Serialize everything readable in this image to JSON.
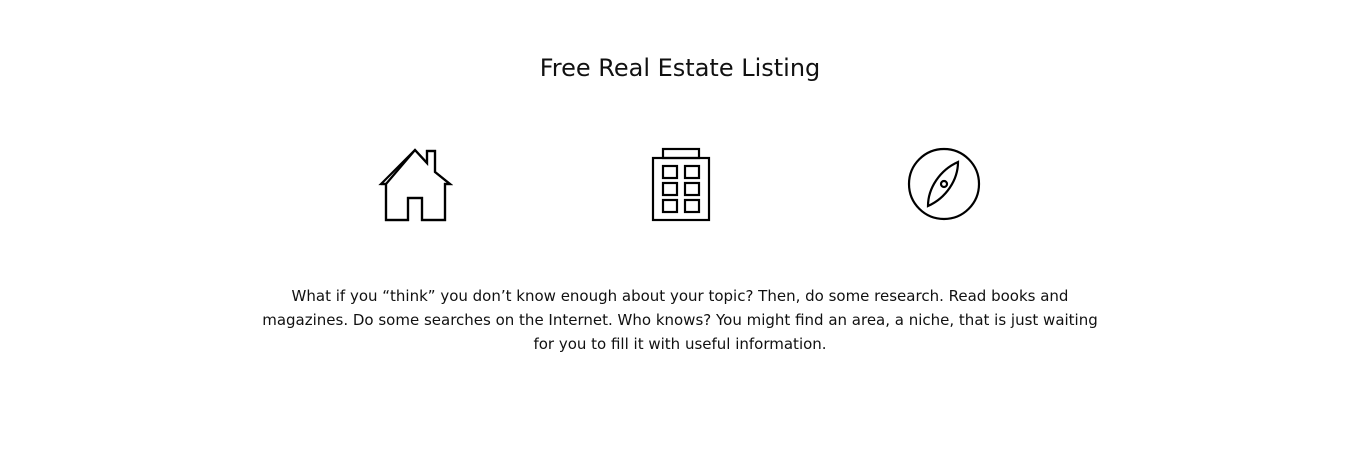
{
  "section": {
    "title": "Free Real Estate Listing",
    "icons": [
      {
        "name": "house-icon"
      },
      {
        "name": "building-icon"
      },
      {
        "name": "compass-icon"
      }
    ],
    "description": "What if you “think” you don’t know enough about your topic? Then, do some research. Read books and magazines. Do some searches on the Internet. Who knows? You might find an area, a niche, that is just waiting for you to fill it with useful information."
  },
  "colors": {
    "text": "#111111",
    "background": "#ffffff",
    "icon_stroke": "#000000"
  }
}
